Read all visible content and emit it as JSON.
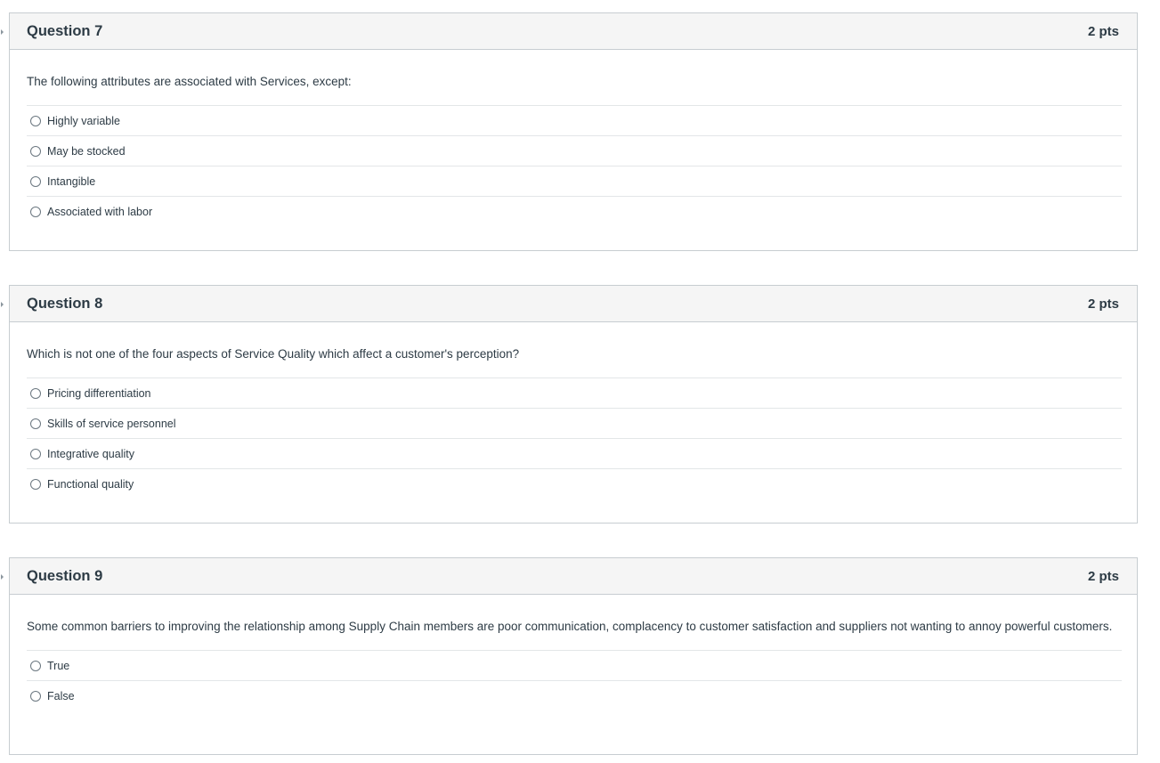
{
  "questions": [
    {
      "title": "Question 7",
      "points": "2 pts",
      "text": "The following attributes are associated with Services, except:",
      "answers": [
        "Highly variable",
        "May be stocked",
        "Intangible",
        "Associated with labor"
      ]
    },
    {
      "title": "Question 8",
      "points": "2 pts",
      "text": "Which is not one of the four aspects of Service Quality which affect a customer's perception?",
      "answers": [
        "Pricing differentiation",
        "Skills of service personnel",
        "Integrative quality",
        "Functional quality"
      ]
    },
    {
      "title": "Question 9",
      "points": "2 pts",
      "text": "Some common barriers to improving the relationship among Supply Chain members are poor communication, complacency to customer satisfaction and suppliers not wanting to annoy powerful customers.",
      "answers": [
        "True",
        "False"
      ]
    }
  ]
}
